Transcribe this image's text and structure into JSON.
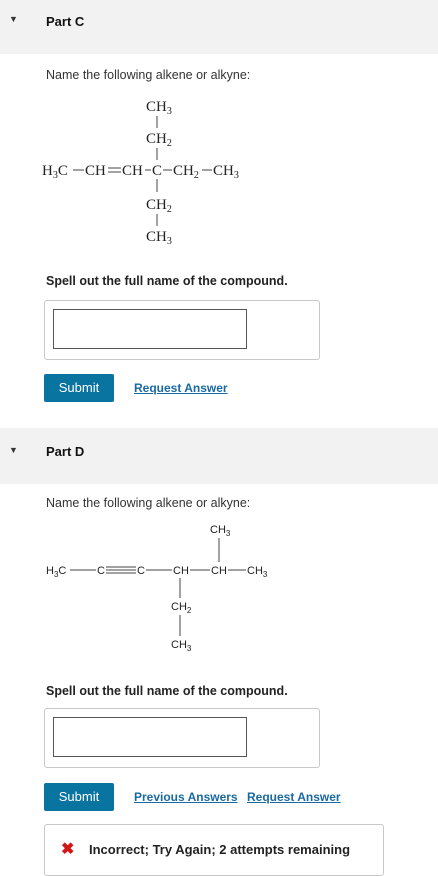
{
  "partC": {
    "label": "Part C",
    "prompt": "Name the following alkene or alkyne:",
    "structure": {
      "top_ch3": "CH",
      "top_ch3_sub": "3",
      "top_ch2": "CH",
      "top_ch2_sub": "2",
      "chain_h3c_h": "H",
      "chain_h3c_sub": "3",
      "chain_h3c_c": "C",
      "chain_ch1": "CH",
      "chain_ch2": "CH",
      "chain_c": "C",
      "chain_ch2b": "CH",
      "chain_ch2b_sub": "2",
      "chain_ch3": "CH",
      "chain_ch3_sub": "3",
      "bot_ch2": "CH",
      "bot_ch2_sub": "2",
      "bot_ch3": "CH",
      "bot_ch3_sub": "3"
    },
    "instruction": "Spell out the full name of the compound.",
    "input_value": "",
    "submit_label": "Submit",
    "request_answer_label": "Request Answer"
  },
  "partD": {
    "label": "Part D",
    "prompt": "Name the following alkene or alkyne:",
    "structure": {
      "top_ch3": "CH",
      "top_ch3_sub": "3",
      "h3c_h": "H",
      "h3c_sub": "3",
      "h3c_c": "C",
      "c1": "C",
      "c2": "C",
      "ch_a": "CH",
      "ch_b": "CH",
      "end_ch3": "CH",
      "end_ch3_sub": "3",
      "bot_ch2": "CH",
      "bot_ch2_sub": "2",
      "bot_ch3": "CH",
      "bot_ch3_sub": "3"
    },
    "instruction": "Spell out the full name of the compound.",
    "input_value": "",
    "submit_label": "Submit",
    "previous_answers_label": "Previous Answers",
    "request_answer_label": "Request Answer",
    "feedback": "Incorrect; Try Again; 2 attempts remaining"
  },
  "colors": {
    "header_bg": "#f2f2f2",
    "button_bg": "#0a74a1",
    "link": "#1a6aa2",
    "error": "#d41515"
  },
  "icons": {
    "collapse": "triangle-down-icon",
    "error": "x-mark-icon"
  }
}
